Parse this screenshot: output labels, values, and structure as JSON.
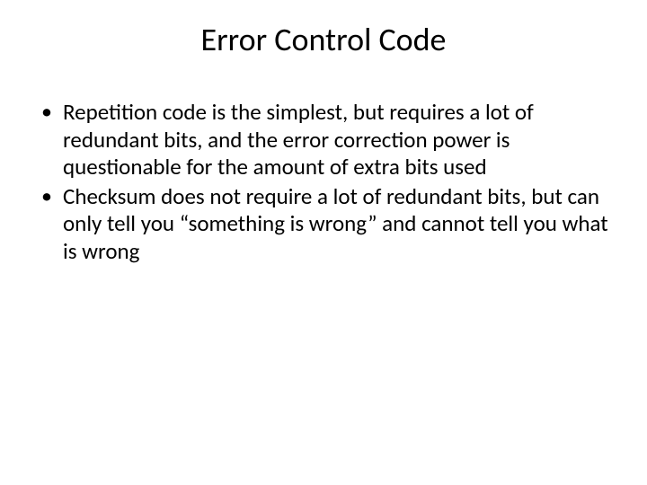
{
  "slide": {
    "title": "Error Control Code",
    "bullets": [
      "Repetition code is the simplest, but requires a lot of redundant bits, and the error correction power is questionable for the amount of extra bits used",
      "Checksum does not require a lot of redundant bits, but can only tell you “something is wrong” and cannot tell you what is wrong"
    ]
  }
}
